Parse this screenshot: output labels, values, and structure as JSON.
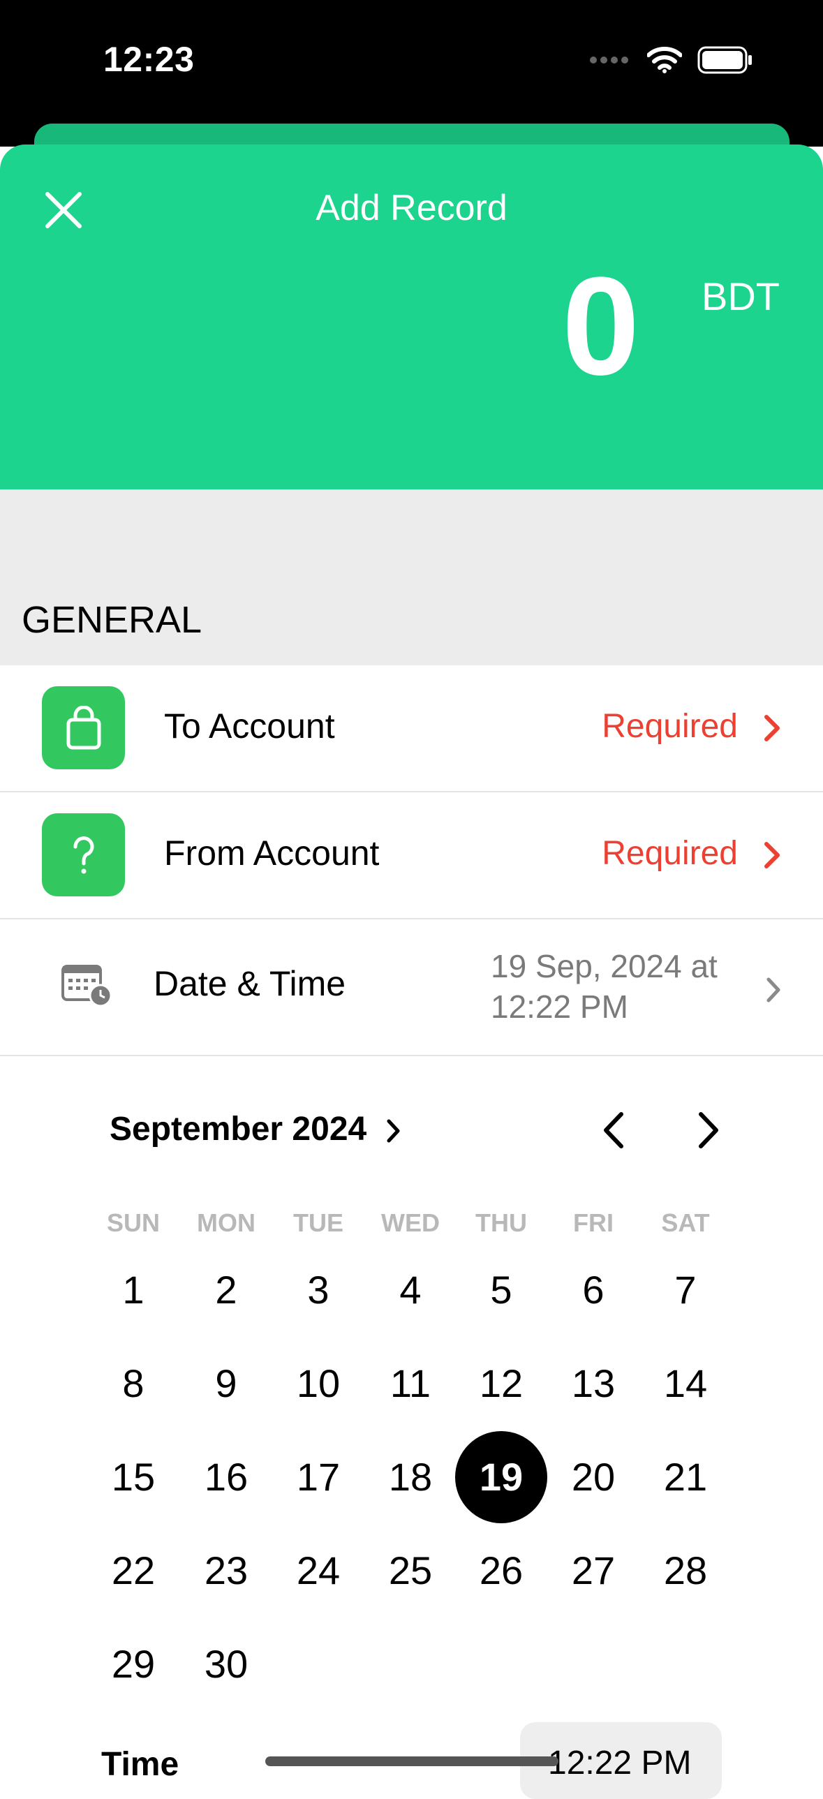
{
  "status_bar": {
    "time": "12:23"
  },
  "header": {
    "title": "Add Record",
    "amount": "0",
    "currency": "BDT",
    "background_color": "#1dd48e"
  },
  "section": {
    "label": "GENERAL"
  },
  "rows": {
    "to_account": {
      "label": "To Account",
      "value": "Required"
    },
    "from_account": {
      "label": "From Account",
      "value": "Required"
    },
    "date_time": {
      "label": "Date & Time",
      "value_line1": "19 Sep, 2024 at",
      "value_line2": "12:22 PM"
    }
  },
  "calendar": {
    "month_title": "September 2024",
    "weekdays": [
      "SUN",
      "MON",
      "TUE",
      "WED",
      "THU",
      "FRI",
      "SAT"
    ],
    "days": [
      "1",
      "2",
      "3",
      "4",
      "5",
      "6",
      "7",
      "8",
      "9",
      "10",
      "11",
      "12",
      "13",
      "14",
      "15",
      "16",
      "17",
      "18",
      "19",
      "20",
      "21",
      "22",
      "23",
      "24",
      "25",
      "26",
      "27",
      "28",
      "29",
      "30"
    ],
    "selected_day": "19"
  },
  "time": {
    "label": "Time",
    "value": "12:22 PM"
  },
  "colors": {
    "required_red": "#eb4032",
    "icon_green": "#33c760"
  },
  "icons": [
    "close-icon",
    "shopping-bag-icon",
    "question-mark-icon",
    "calendar-clock-icon",
    "chevron-right-icon",
    "chevron-left-icon",
    "wifi-icon",
    "battery-icon",
    "signal-icon"
  ]
}
